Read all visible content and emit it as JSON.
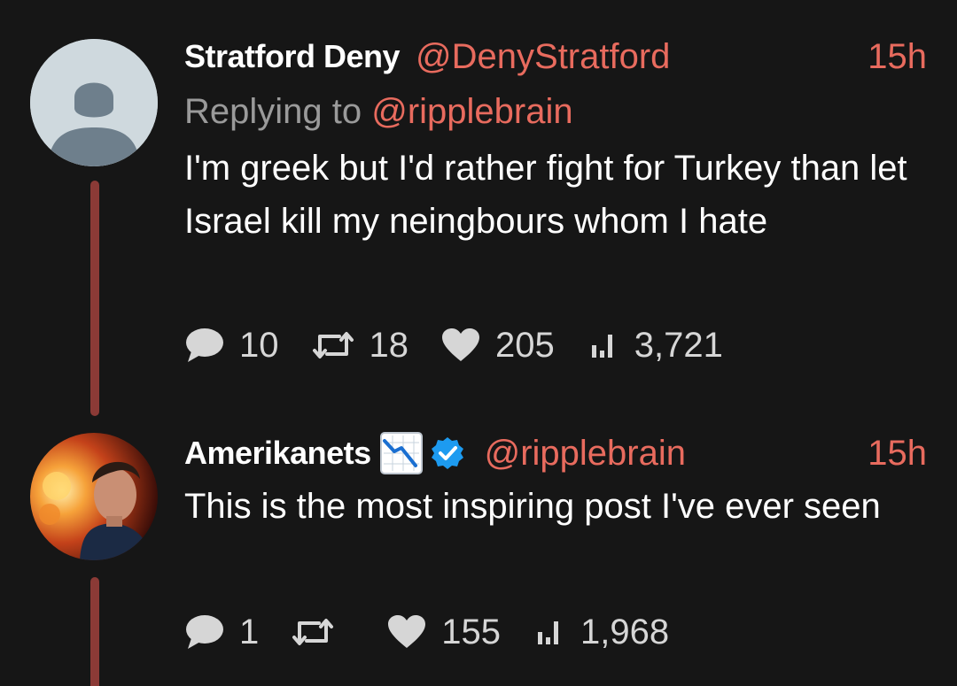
{
  "colors": {
    "background": "#161616",
    "accent": "#e86b5e",
    "thread_line": "#8b3a36",
    "muted": "#9a9a9a",
    "action_text": "#d6d6d6",
    "verified": "#1d9bf0"
  },
  "tweets": [
    {
      "display_name": "Stratford Deny",
      "handle": "@DenyStratford",
      "time": "15h",
      "replying_prefix": "Replying to ",
      "replying_to": "@ripplebrain",
      "text": "I'm greek but I'd rather fight for Turkey than let Israel kill my neingbours whom I hate",
      "avatar": "default-avatar-icon",
      "stats": {
        "replies": "10",
        "retweets": "18",
        "likes": "205",
        "views": "3,721"
      }
    },
    {
      "display_name": "Amerikanets",
      "name_emoji": "chart-decreasing-icon",
      "verified": true,
      "handle": "@ripplebrain",
      "time": "15h",
      "text": "This is the most inspiring post I've ever seen",
      "avatar": "profile-photo",
      "stats": {
        "replies": "1",
        "retweets": "",
        "likes": "155",
        "views": "1,968"
      }
    }
  ]
}
